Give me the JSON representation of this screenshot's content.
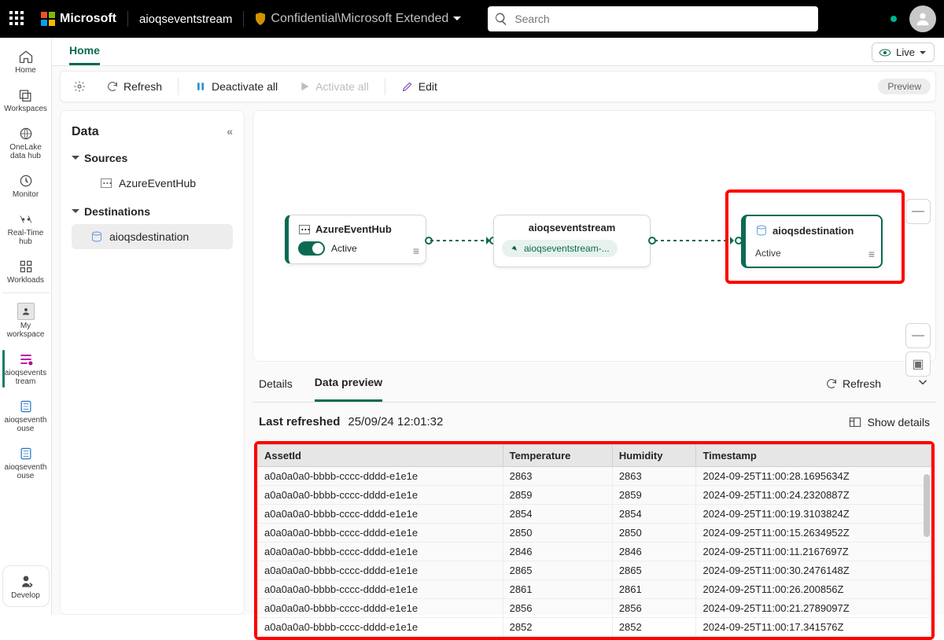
{
  "topbar": {
    "brand": "Microsoft",
    "resource": "aioqseventstream",
    "classification": "Confidential\\Microsoft Extended",
    "search_placeholder": "Search"
  },
  "rail": [
    {
      "label": "Home"
    },
    {
      "label": "Workspaces"
    },
    {
      "label": "OneLake\ndata hub"
    },
    {
      "label": "Monitor"
    },
    {
      "label": "Real-Time\nhub"
    },
    {
      "label": "Workloads"
    },
    {
      "label": "My\nworkspace"
    },
    {
      "label": "aioqsevents\ntream",
      "active": true
    },
    {
      "label": "aioqseventh\nouse"
    },
    {
      "label": "aioqseventh\nouse"
    },
    {
      "label": "Develop"
    }
  ],
  "tabs": {
    "home": "Home",
    "live": "Live"
  },
  "toolbar": {
    "refresh": "Refresh",
    "deactivate": "Deactivate all",
    "activate": "Activate all",
    "edit": "Edit",
    "preview": "Preview"
  },
  "dataPanel": {
    "title": "Data",
    "sources": "Sources",
    "source1": "AzureEventHub",
    "destinations": "Destinations",
    "dest1": "aioqsdestination"
  },
  "canvas": {
    "src_name": "AzureEventHub",
    "src_status": "Active",
    "mid_name": "aioqseventstream",
    "mid_chip": "aioqseventstream-...",
    "dest_name": "aioqsdestination",
    "dest_status": "Active"
  },
  "preview": {
    "tab_details": "Details",
    "tab_data": "Data preview",
    "refresh": "Refresh",
    "last_refreshed_label": "Last refreshed",
    "last_refreshed_ts": "25/09/24 12:01:32",
    "show_details": "Show details",
    "columns": [
      "AssetId",
      "Temperature",
      "Humidity",
      "Timestamp"
    ],
    "rows": [
      [
        "a0a0a0a0-bbbb-cccc-dddd-e1e1e",
        "2863",
        "2863",
        "2024-09-25T11:00:28.1695634Z"
      ],
      [
        "a0a0a0a0-bbbb-cccc-dddd-e1e1e",
        "2859",
        "2859",
        "2024-09-25T11:00:24.2320887Z"
      ],
      [
        "a0a0a0a0-bbbb-cccc-dddd-e1e1e",
        "2854",
        "2854",
        "2024-09-25T11:00:19.3103824Z"
      ],
      [
        "a0a0a0a0-bbbb-cccc-dddd-e1e1e",
        "2850",
        "2850",
        "2024-09-25T11:00:15.2634952Z"
      ],
      [
        "a0a0a0a0-bbbb-cccc-dddd-e1e1e",
        "2846",
        "2846",
        "2024-09-25T11:00:11.2167697Z"
      ],
      [
        "a0a0a0a0-bbbb-cccc-dddd-e1e1e",
        "2865",
        "2865",
        "2024-09-25T11:00:30.2476148Z"
      ],
      [
        "a0a0a0a0-bbbb-cccc-dddd-e1e1e",
        "2861",
        "2861",
        "2024-09-25T11:00:26.200856Z"
      ],
      [
        "a0a0a0a0-bbbb-cccc-dddd-e1e1e",
        "2856",
        "2856",
        "2024-09-25T11:00:21.2789097Z"
      ],
      [
        "a0a0a0a0-bbbb-cccc-dddd-e1e1e",
        "2852",
        "2852",
        "2024-09-25T11:00:17.341576Z"
      ]
    ]
  }
}
